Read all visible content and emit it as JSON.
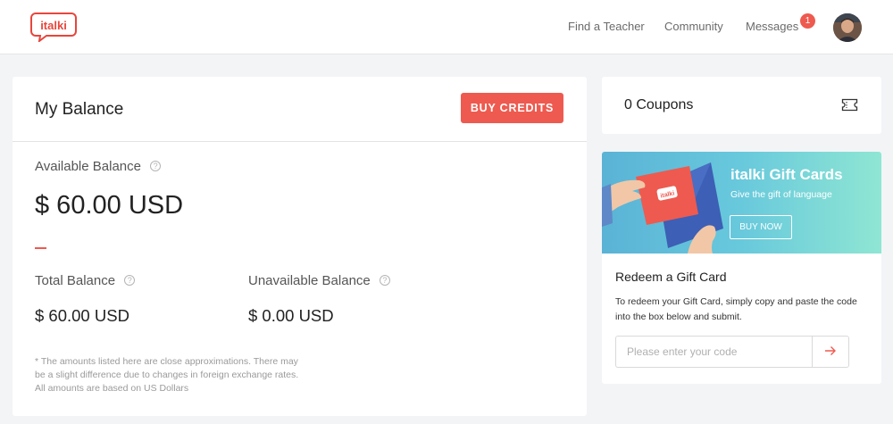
{
  "header": {
    "logo_text": "italki",
    "nav": {
      "find_teacher": "Find a Teacher",
      "community": "Community",
      "messages": "Messages"
    },
    "messages_badge": "1"
  },
  "balance": {
    "title": "My Balance",
    "buy_credits_label": "BUY CREDITS",
    "available_label": "Available Balance",
    "available_amount": "$ 60.00 USD",
    "total_label": "Total Balance",
    "total_amount": "$ 60.00 USD",
    "unavailable_label": "Unavailable Balance",
    "unavailable_amount": "$ 0.00 USD",
    "note": "* The amounts listed here are close approximations. There may be a slight difference due to changes in foreign exchange rates. All amounts are based on US Dollars"
  },
  "coupons": {
    "label": "0 Coupons"
  },
  "gift": {
    "banner_title": "italki Gift Cards",
    "banner_subtitle": "Give the gift of language",
    "buy_now_label": "BUY NOW",
    "card_logo_text": "italki",
    "redeem_title": "Redeem a Gift Card",
    "redeem_description": "To redeem your Gift Card, simply copy and paste the code into the box below and submit.",
    "code_placeholder": "Please enter your code"
  },
  "colors": {
    "accent": "#ee5a4f",
    "page_bg": "#f3f4f6",
    "banner_start": "#5ab3d6",
    "banner_end": "#8fe6d3"
  },
  "icons": {
    "help": "question-circle-icon",
    "ticket": "ticket-icon",
    "submit": "arrow-right-icon"
  }
}
